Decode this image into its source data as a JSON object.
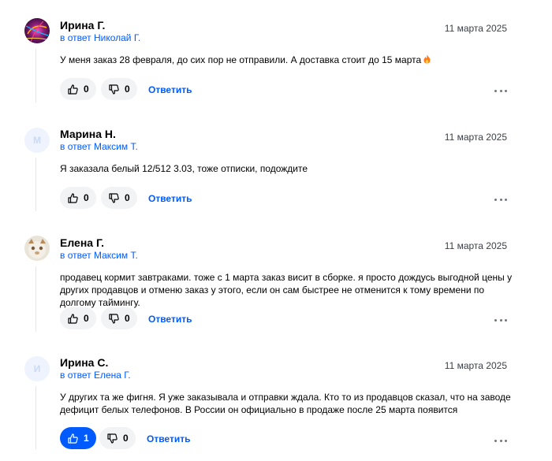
{
  "comments": [
    {
      "author": "Ирина Г.",
      "reply_to": "в ответ Николай Г.",
      "date": "11 марта 2025",
      "text": "У меня заказ 28 февраля, до сих пор не отправили. А доставка стоит до 15 марта",
      "emoji": "fire-emoji",
      "likes": "0",
      "dislikes": "0",
      "reply_label": "Ответить",
      "avatar_initial": ""
    },
    {
      "author": "Марина Н.",
      "reply_to": "в ответ Максим Т.",
      "date": "11 марта 2025",
      "text": "Я заказала белый 12/512 3.03, тоже отписки, подождите",
      "likes": "0",
      "dislikes": "0",
      "reply_label": "Ответить",
      "avatar_initial": "М"
    },
    {
      "author": "Елена Г.",
      "reply_to": "в ответ Максим Т.",
      "date": "11 марта 2025",
      "text": "продавец кормит завтраками. тоже с 1 марта заказ висит в сборке. я просто дождусь выгодной цены у других продавцов и отменю заказ у этого, если он сам быстрее не отменится к тому времени по долгому таймингу.",
      "likes": "0",
      "dislikes": "0",
      "reply_label": "Ответить",
      "avatar_initial": ""
    },
    {
      "author": "Ирина С.",
      "reply_to": "в ответ Елена Г.",
      "date": "11 марта 2025",
      "text": "У других та же фигня. Я уже заказывала и отправки ждала. Кто то из продавцов сказал, что на заводе дефицит белых телефонов. В России он официально в продаже после 25 марта появится",
      "likes": "1",
      "dislikes": "0",
      "reply_label": "Ответить",
      "avatar_initial": "И",
      "liked": true
    }
  ],
  "colors": {
    "accent": "#005bff",
    "pill_bg": "#f2f3f5",
    "thread_line": "#e6e6eb"
  }
}
